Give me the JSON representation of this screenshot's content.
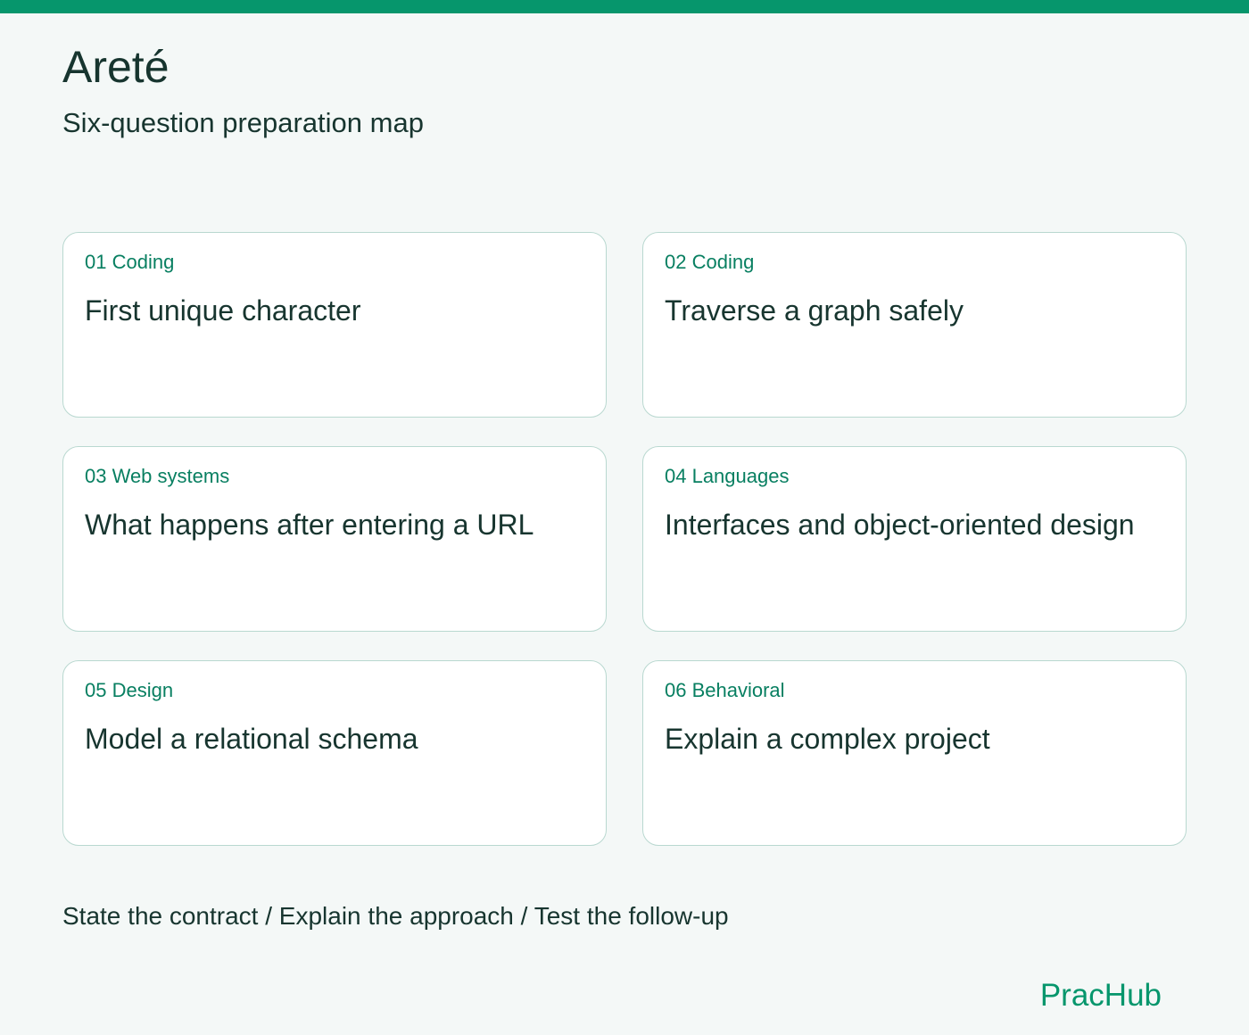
{
  "header": {
    "title": "Areté",
    "subtitle": "Six-question preparation map"
  },
  "questions": [
    {
      "category": "01 Coding",
      "title": "First unique character"
    },
    {
      "category": "02 Coding",
      "title": "Traverse a graph safely"
    },
    {
      "category": "03 Web systems",
      "title": "What happens after entering a URL"
    },
    {
      "category": "04 Languages",
      "title": "Interfaces and object-oriented design"
    },
    {
      "category": "05 Design",
      "title": "Model a relational schema"
    },
    {
      "category": "06 Behavioral",
      "title": "Explain a complex project"
    }
  ],
  "footer": {
    "steps": "State the contract / Explain the approach / Test the follow-up",
    "brand": "PracHub"
  },
  "colors": {
    "accent": "#06966c",
    "category_text": "#087f61",
    "text": "#17352f",
    "background": "#f4f8f7",
    "card_border": "#b9d8d0"
  }
}
